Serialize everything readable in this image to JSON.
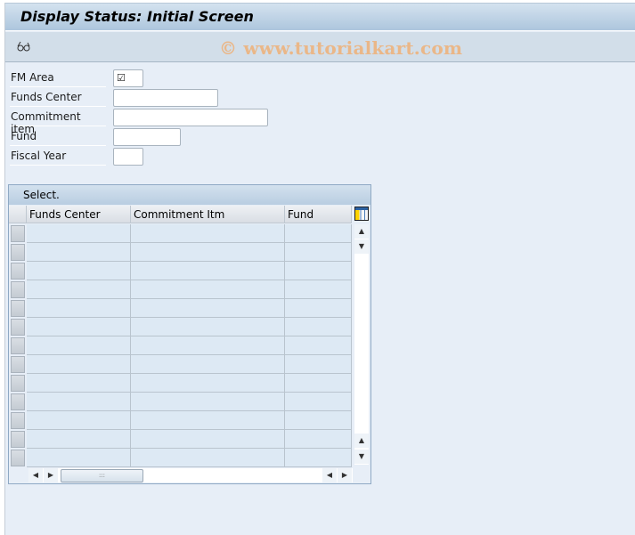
{
  "window": {
    "title": "Display Status: Initial Screen"
  },
  "toolbar": {
    "icons": [
      {
        "name": "glasses-icon",
        "glyph": "∞̸"
      }
    ],
    "watermark": "© www.tutorialkart.com"
  },
  "form": {
    "fields": [
      {
        "label": "FM Area",
        "value": "☑",
        "type": "checkbox"
      },
      {
        "label": "Funds Center",
        "value": "",
        "type": "text"
      },
      {
        "label": "Commitment item",
        "value": "",
        "type": "text"
      },
      {
        "label": "Fund",
        "value": "",
        "type": "text"
      },
      {
        "label": "Fiscal Year",
        "value": "",
        "type": "text"
      }
    ]
  },
  "grid": {
    "title": "Select.",
    "columns": [
      "Funds Center",
      "Commitment Itm",
      "Fund"
    ],
    "rows": [
      [
        "",
        "",
        ""
      ],
      [
        "",
        "",
        ""
      ],
      [
        "",
        "",
        ""
      ],
      [
        "",
        "",
        ""
      ],
      [
        "",
        "",
        ""
      ],
      [
        "",
        "",
        ""
      ],
      [
        "",
        "",
        ""
      ],
      [
        "",
        "",
        ""
      ],
      [
        "",
        "",
        ""
      ],
      [
        "",
        "",
        ""
      ],
      [
        "",
        "",
        ""
      ],
      [
        "",
        "",
        ""
      ],
      [
        "",
        "",
        ""
      ]
    ],
    "scroll": {
      "up": "▲",
      "down": "▼",
      "left": "◀",
      "right": "▶",
      "thumb_grip": ":::"
    }
  }
}
